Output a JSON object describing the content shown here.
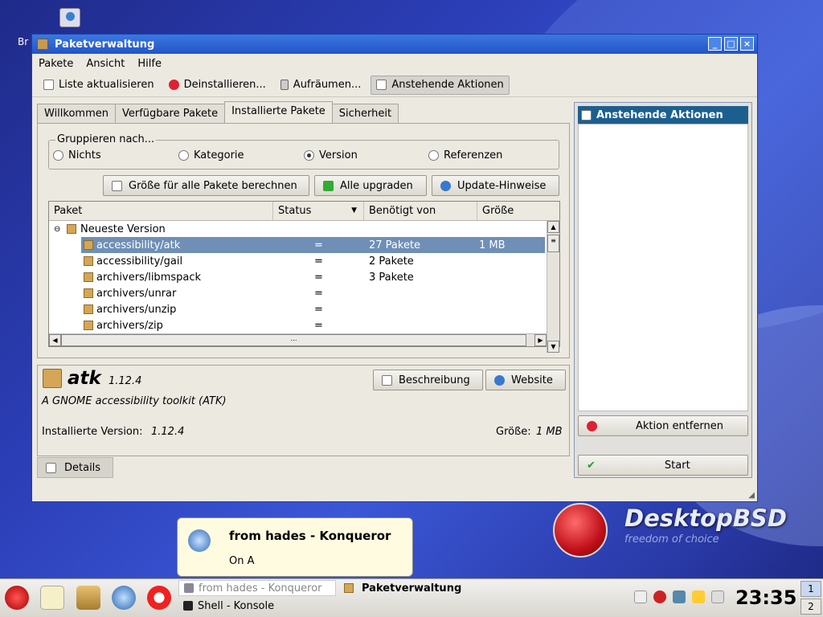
{
  "desktop": {
    "icon_label": "Br"
  },
  "window": {
    "title": "Paketverwaltung",
    "menu": [
      "Pakete",
      "Ansicht",
      "Hilfe"
    ],
    "toolbar": [
      "Liste aktualisieren",
      "Deinstallieren...",
      "Aufräumen...",
      "Anstehende Aktionen"
    ],
    "tabs": [
      "Willkommen",
      "Verfügbare Pakete",
      "Installierte Pakete",
      "Sicherheit"
    ],
    "group": {
      "title": "Gruppieren nach...",
      "options": [
        "Nichts",
        "Kategorie",
        "Version",
        "Referenzen"
      ],
      "selected": "Version"
    },
    "buttons": [
      "Größe für alle Pakete berechnen",
      "Alle upgraden",
      "Update-Hinweise"
    ],
    "table": {
      "headers": [
        "Paket",
        "Status",
        "Benötigt von",
        "Größe"
      ],
      "group_label": "Neueste Version",
      "rows": [
        {
          "name": "accessibility/atk",
          "status": "=",
          "required": "27 Pakete",
          "size": "1 MB"
        },
        {
          "name": "accessibility/gail",
          "status": "=",
          "required": "2 Pakete",
          "size": ""
        },
        {
          "name": "archivers/libmspack",
          "status": "=",
          "required": "3 Pakete",
          "size": ""
        },
        {
          "name": "archivers/unrar",
          "status": "=",
          "required": "",
          "size": ""
        },
        {
          "name": "archivers/unzip",
          "status": "=",
          "required": "",
          "size": ""
        },
        {
          "name": "archivers/zip",
          "status": "=",
          "required": "",
          "size": ""
        }
      ]
    },
    "details": {
      "name": "atk",
      "version": "1.12.4",
      "description": "A GNOME accessibility toolkit (ATK)",
      "installed_label": "Installierte Version:",
      "installed_value": "1.12.4",
      "size_label": "Größe:",
      "size_value": "1 MB",
      "desc_button": "Beschreibung",
      "web_button": "Website",
      "details_tab": "Details"
    },
    "pending": {
      "title": "Anstehende Aktionen",
      "remove_button": "Aktion entfernen",
      "start_button": "Start"
    }
  },
  "notification": {
    "title": "from hades - Konqueror",
    "body": "On A"
  },
  "branding": {
    "name": "DesktopBSD",
    "tagline": "freedom of choice"
  },
  "taskbar": {
    "tasks": [
      "from hades - Konqueror",
      "Paketverwaltung",
      "Shell - Konsole"
    ],
    "clock": "23:35",
    "pager": [
      "1",
      "2"
    ]
  }
}
